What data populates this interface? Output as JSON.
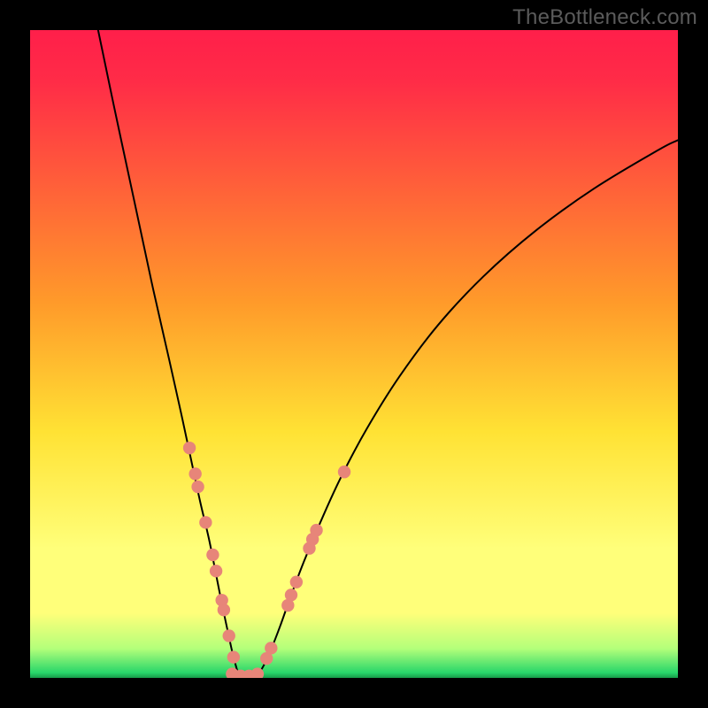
{
  "watermark": "TheBottleneck.com",
  "colors": {
    "top": "#ff1f4a",
    "red": "#ff2c47",
    "orange": "#ff9a2a",
    "yellow": "#ffe234",
    "yellow_pale": "#ffff7a",
    "green_up": "#b3ff7a",
    "green": "#28d66a",
    "green_deep": "#179a49",
    "curve": "#000000",
    "dot": "#e78579"
  },
  "chart_data": {
    "type": "line",
    "title": "",
    "xlabel": "",
    "ylabel": "",
    "xlim": [
      0,
      100
    ],
    "ylim": [
      0,
      100
    ],
    "grid": false,
    "legend": false,
    "notes": "No numeric axes or tick labels are rendered; x/y are normalized to 0–100 matching the plot area. Two black curves descend from top toward a narrow flat trough near (31–35, 0) then the right branch rises again. Salmon dots cluster along the lower segments of both branches and along the trough.",
    "series": [
      {
        "name": "left-branch",
        "x": [
          10.5,
          13,
          16,
          19,
          21.5,
          23.5,
          25,
          26.3,
          27.6,
          28.7,
          29.7,
          30.6,
          31.3,
          31.9,
          32.2
        ],
        "values": [
          100,
          88,
          74,
          60,
          49,
          40,
          33,
          27,
          21.5,
          16,
          11,
          6.8,
          3.6,
          1.4,
          0.3
        ]
      },
      {
        "name": "trough",
        "x": [
          31.0,
          32.0,
          33.0,
          34.0,
          35.0
        ],
        "values": [
          0.2,
          0.0,
          0.0,
          0.0,
          0.2
        ]
      },
      {
        "name": "right-branch",
        "x": [
          35.0,
          36.0,
          37.2,
          38.6,
          40.2,
          42.2,
          44.8,
          48,
          52,
          57,
          63,
          70,
          78,
          87,
          97,
          100
        ],
        "values": [
          0.3,
          1.8,
          4.4,
          8.0,
          12.5,
          17.8,
          24,
          31,
          38.5,
          46.5,
          54.5,
          62,
          69,
          75.5,
          81.5,
          83
        ]
      }
    ],
    "dots": [
      {
        "x": 24.6,
        "y": 35.5
      },
      {
        "x": 25.5,
        "y": 31.5
      },
      {
        "x": 25.9,
        "y": 29.5
      },
      {
        "x": 27.1,
        "y": 24.0
      },
      {
        "x": 28.2,
        "y": 19.0
      },
      {
        "x": 28.7,
        "y": 16.5
      },
      {
        "x": 29.6,
        "y": 12.0
      },
      {
        "x": 29.9,
        "y": 10.5
      },
      {
        "x": 30.7,
        "y": 6.5
      },
      {
        "x": 31.4,
        "y": 3.2
      },
      {
        "x": 31.2,
        "y": 0.6
      },
      {
        "x": 32.5,
        "y": 0.3
      },
      {
        "x": 33.8,
        "y": 0.3
      },
      {
        "x": 35.1,
        "y": 0.6
      },
      {
        "x": 36.5,
        "y": 3.0
      },
      {
        "x": 37.2,
        "y": 4.6
      },
      {
        "x": 39.8,
        "y": 11.2
      },
      {
        "x": 40.3,
        "y": 12.8
      },
      {
        "x": 41.1,
        "y": 14.8
      },
      {
        "x": 43.1,
        "y": 20.0
      },
      {
        "x": 43.6,
        "y": 21.4
      },
      {
        "x": 44.2,
        "y": 22.8
      },
      {
        "x": 48.5,
        "y": 31.8
      }
    ]
  }
}
